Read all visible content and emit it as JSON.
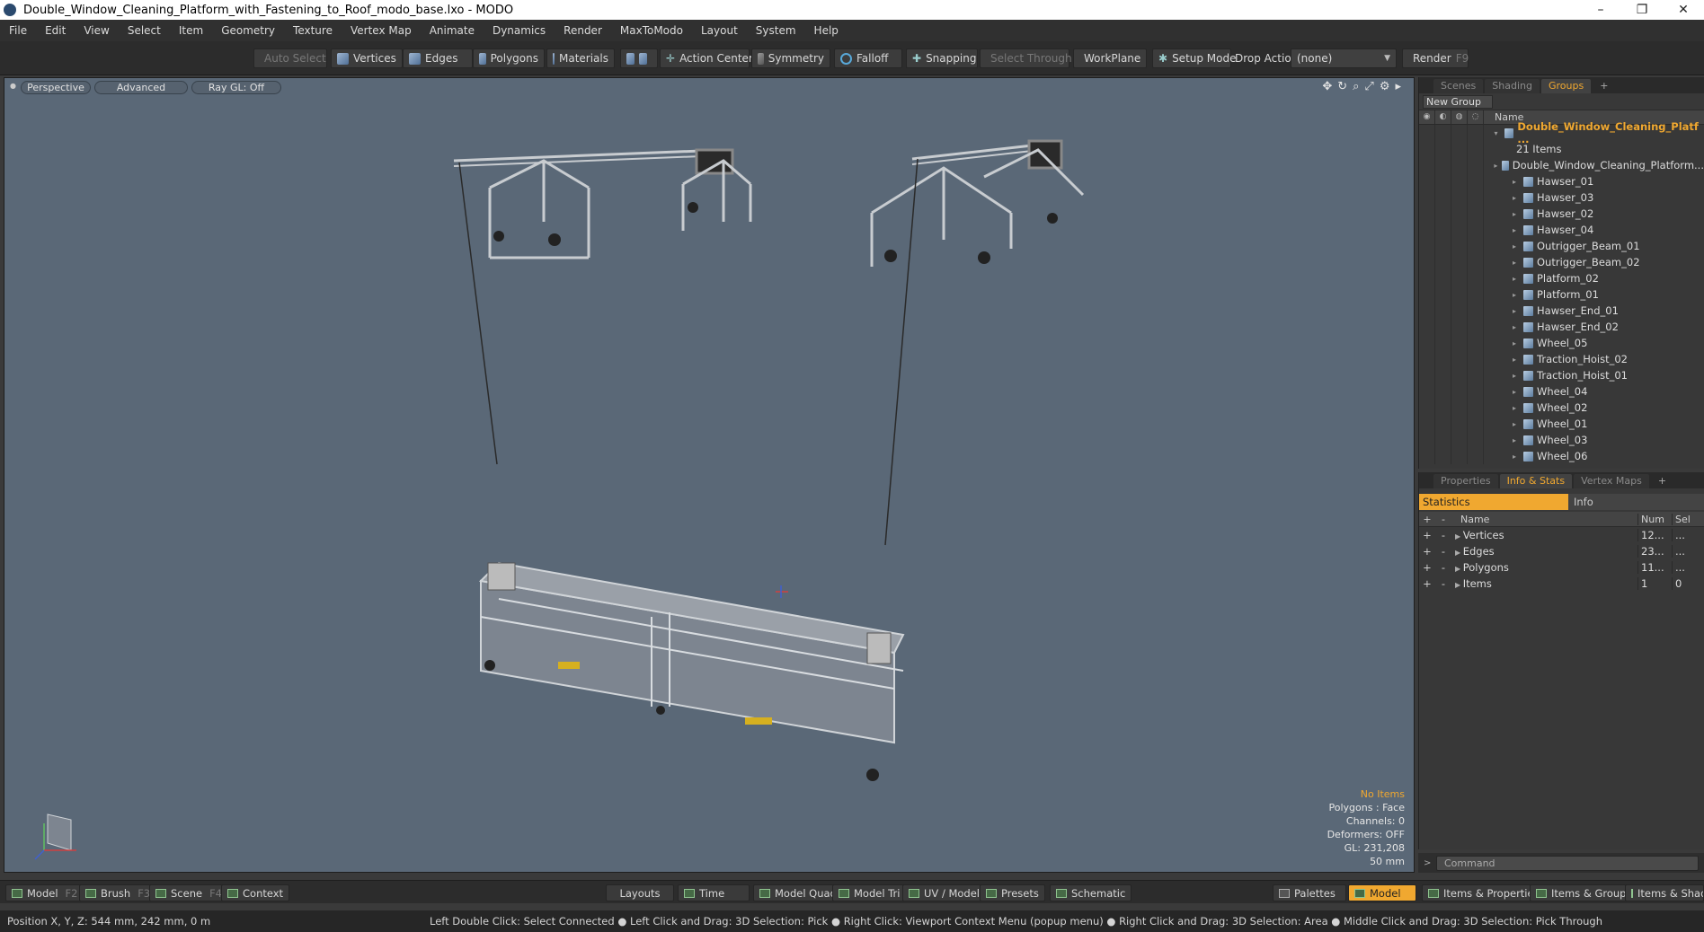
{
  "window": {
    "title": "Double_Window_Cleaning_Platform_with_Fastening_to_Roof_modo_base.lxo - MODO",
    "controls": [
      "–",
      "❐",
      "✕"
    ]
  },
  "menu": [
    "File",
    "Edit",
    "View",
    "Select",
    "Item",
    "Geometry",
    "Texture",
    "Vertex Map",
    "Animate",
    "Dynamics",
    "Render",
    "MaxToModo",
    "Layout",
    "System",
    "Help"
  ],
  "toolbar": {
    "auto_select": "Auto Select",
    "vertices": "Vertices",
    "edges": "Edges",
    "polygons": "Polygons",
    "materials": "Materials",
    "action_center": "Action Center",
    "symmetry": "Symmetry",
    "falloff": "Falloff",
    "snapping": "Snapping",
    "select_through": "Select Through",
    "workplane": "WorkPlane",
    "setup_mode": "Setup Mode",
    "drop_action": "Drop Action",
    "drop_value": "(none)",
    "render": "Render",
    "render_key": "F9"
  },
  "viewport": {
    "perspective": "Perspective",
    "advanced": "Advanced",
    "raygl": "Ray GL: Off",
    "hud": {
      "no_items": "No Items",
      "polygons": "Polygons : Face",
      "channels": "Channels: 0",
      "deformers": "Deformers: OFF",
      "gl": "GL: 231,208",
      "scale": "50 mm"
    }
  },
  "scene_panel": {
    "tabs": [
      "Scenes",
      "Shading",
      "Groups",
      "+"
    ],
    "active_tab": "Groups",
    "new_group": "New Group",
    "name_header": "Name",
    "group_name": "Double_Window_Cleaning_Platf ...",
    "group_count": "21 Items",
    "items": [
      "Double_Window_Cleaning_Platform...",
      "Hawser_01",
      "Hawser_03",
      "Hawser_02",
      "Hawser_04",
      "Outrigger_Beam_01",
      "Outrigger_Beam_02",
      "Platform_02",
      "Platform_01",
      "Hawser_End_01",
      "Hawser_End_02",
      "Wheel_05",
      "Traction_Hoist_02",
      "Traction_Hoist_01",
      "Wheel_04",
      "Wheel_02",
      "Wheel_01",
      "Wheel_03",
      "Wheel_06"
    ]
  },
  "stats_panel": {
    "tabs": [
      "Properties",
      "Info & Stats",
      "Vertex Maps",
      "+"
    ],
    "active_tab": "Info & Stats",
    "sub_tabs": {
      "statistics": "Statistics",
      "info": "Info"
    },
    "headers": {
      "name": "Name",
      "num": "Num",
      "sel": "Sel"
    },
    "rows": [
      {
        "name": "Vertices",
        "num": "12...",
        "sel": "..."
      },
      {
        "name": "Edges",
        "num": "23...",
        "sel": "..."
      },
      {
        "name": "Polygons",
        "num": "11...",
        "sel": "..."
      },
      {
        "name": "Items",
        "num": "1",
        "sel": "0"
      }
    ]
  },
  "command": {
    "placeholder": "Command"
  },
  "bottom": {
    "model": "Model",
    "model_key": "F2",
    "brush": "Brush",
    "brush_key": "F3",
    "scene": "Scene",
    "scene_key": "F4",
    "context": "Context",
    "layouts": "Layouts",
    "time": "Time",
    "model_quad": "Model Quad",
    "model_tri": "Model Tri",
    "uv_model": "UV / Model",
    "presets": "Presets",
    "schematic": "Schematic",
    "palettes": "Palettes",
    "model_active": "Model",
    "items_properties": "Items & Properties",
    "items_groups": "Items & Groups",
    "items_shading": "Items & Shadi"
  },
  "status": {
    "position": "Position X, Y, Z:   544 mm, 242 mm, 0 m",
    "hints": "Left Double Click: Select Connected ● Left Click and Drag: 3D Selection: Pick ● Right Click: Viewport Context Menu (popup menu) ● Right Click and Drag: 3D Selection: Area ● Middle Click and Drag: 3D Selection: Pick Through"
  },
  "colors": {
    "accent": "#f0a830",
    "viewport_bg": "#5a6877"
  }
}
